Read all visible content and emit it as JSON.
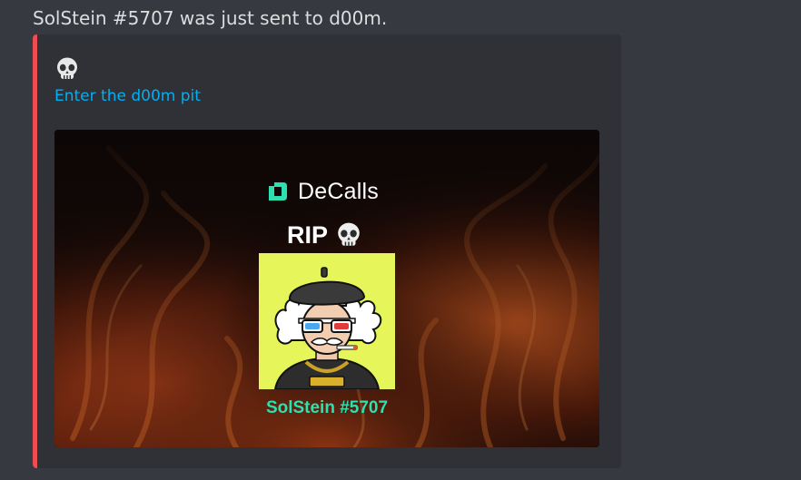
{
  "message": {
    "text": "SolStein #5707 was just sent to d00m."
  },
  "embed": {
    "accent_color": "#ed4c53",
    "icon": "skull-icon",
    "link_text": "Enter the d00m pit",
    "image": {
      "brand_name": "DeCalls",
      "brand_color": "#2de0b0",
      "rip_label": "RIP",
      "rip_icon": "skull-icon",
      "nft_background": "#e6f55a",
      "nft_name": "SolStein #5707"
    }
  }
}
